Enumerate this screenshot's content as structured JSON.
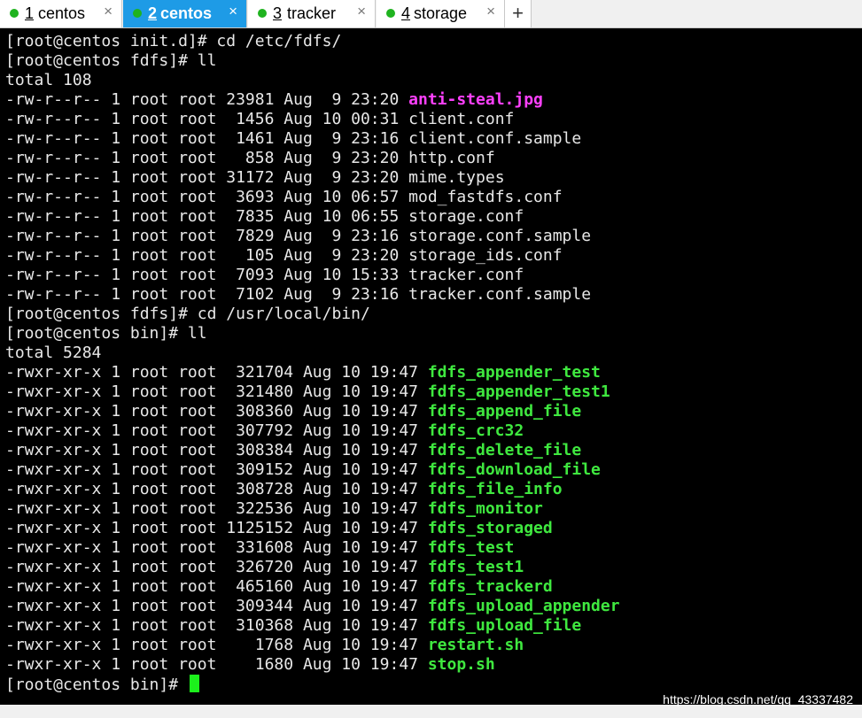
{
  "tabs": [
    {
      "num": "1",
      "label": "centos",
      "active": false
    },
    {
      "num": "2",
      "label": "centos",
      "active": true
    },
    {
      "num": "3",
      "label": "tracker",
      "active": false
    },
    {
      "num": "4",
      "label": "storage",
      "active": false
    }
  ],
  "tab_close_glyph": "×",
  "new_tab_glyph": "+",
  "colors": {
    "terminal_bg": "#000000",
    "terminal_fg": "#e8e8e8",
    "active_tab": "#1e9be6",
    "status_dot": "#1fb31f",
    "highlight_file": "#ff40ff",
    "executable_file": "#3fe83f",
    "cursor": "#1cf01c"
  },
  "terminal": {
    "lines": [
      {
        "text": "[root@centos init.d]# cd /etc/fdfs/"
      },
      {
        "text": "[root@centos fdfs]# ll"
      },
      {
        "text": "total 108"
      },
      {
        "text": "-rw-r--r-- 1 root root 23981 Aug  9 23:20 ",
        "name": "anti-steal.jpg",
        "style": "pink"
      },
      {
        "text": "-rw-r--r-- 1 root root  1456 Aug 10 00:31 ",
        "name": "client.conf"
      },
      {
        "text": "-rw-r--r-- 1 root root  1461 Aug  9 23:16 ",
        "name": "client.conf.sample"
      },
      {
        "text": "-rw-r--r-- 1 root root   858 Aug  9 23:20 ",
        "name": "http.conf"
      },
      {
        "text": "-rw-r--r-- 1 root root 31172 Aug  9 23:20 ",
        "name": "mime.types"
      },
      {
        "text": "-rw-r--r-- 1 root root  3693 Aug 10 06:57 ",
        "name": "mod_fastdfs.conf"
      },
      {
        "text": "-rw-r--r-- 1 root root  7835 Aug 10 06:55 ",
        "name": "storage.conf"
      },
      {
        "text": "-rw-r--r-- 1 root root  7829 Aug  9 23:16 ",
        "name": "storage.conf.sample"
      },
      {
        "text": "-rw-r--r-- 1 root root   105 Aug  9 23:20 ",
        "name": "storage_ids.conf"
      },
      {
        "text": "-rw-r--r-- 1 root root  7093 Aug 10 15:33 ",
        "name": "tracker.conf"
      },
      {
        "text": "-rw-r--r-- 1 root root  7102 Aug  9 23:16 ",
        "name": "tracker.conf.sample"
      },
      {
        "text": "[root@centos fdfs]# cd /usr/local/bin/"
      },
      {
        "text": "[root@centos bin]# ll"
      },
      {
        "text": "total 5284"
      },
      {
        "text": "-rwxr-xr-x 1 root root  321704 Aug 10 19:47 ",
        "name": "fdfs_appender_test",
        "style": "green"
      },
      {
        "text": "-rwxr-xr-x 1 root root  321480 Aug 10 19:47 ",
        "name": "fdfs_appender_test1",
        "style": "green"
      },
      {
        "text": "-rwxr-xr-x 1 root root  308360 Aug 10 19:47 ",
        "name": "fdfs_append_file",
        "style": "green"
      },
      {
        "text": "-rwxr-xr-x 1 root root  307792 Aug 10 19:47 ",
        "name": "fdfs_crc32",
        "style": "green"
      },
      {
        "text": "-rwxr-xr-x 1 root root  308384 Aug 10 19:47 ",
        "name": "fdfs_delete_file",
        "style": "green"
      },
      {
        "text": "-rwxr-xr-x 1 root root  309152 Aug 10 19:47 ",
        "name": "fdfs_download_file",
        "style": "green"
      },
      {
        "text": "-rwxr-xr-x 1 root root  308728 Aug 10 19:47 ",
        "name": "fdfs_file_info",
        "style": "green"
      },
      {
        "text": "-rwxr-xr-x 1 root root  322536 Aug 10 19:47 ",
        "name": "fdfs_monitor",
        "style": "green"
      },
      {
        "text": "-rwxr-xr-x 1 root root 1125152 Aug 10 19:47 ",
        "name": "fdfs_storaged",
        "style": "green"
      },
      {
        "text": "-rwxr-xr-x 1 root root  331608 Aug 10 19:47 ",
        "name": "fdfs_test",
        "style": "green"
      },
      {
        "text": "-rwxr-xr-x 1 root root  326720 Aug 10 19:47 ",
        "name": "fdfs_test1",
        "style": "green"
      },
      {
        "text": "-rwxr-xr-x 1 root root  465160 Aug 10 19:47 ",
        "name": "fdfs_trackerd",
        "style": "green"
      },
      {
        "text": "-rwxr-xr-x 1 root root  309344 Aug 10 19:47 ",
        "name": "fdfs_upload_appender",
        "style": "green"
      },
      {
        "text": "-rwxr-xr-x 1 root root  310368 Aug 10 19:47 ",
        "name": "fdfs_upload_file",
        "style": "green"
      },
      {
        "text": "-rwxr-xr-x 1 root root    1768 Aug 10 19:47 ",
        "name": "restart.sh",
        "style": "green"
      },
      {
        "text": "-rwxr-xr-x 1 root root    1680 Aug 10 19:47 ",
        "name": "stop.sh",
        "style": "green"
      }
    ],
    "prompt": "[root@centos bin]# "
  },
  "watermark": "https://blog.csdn.net/qq_43337482"
}
